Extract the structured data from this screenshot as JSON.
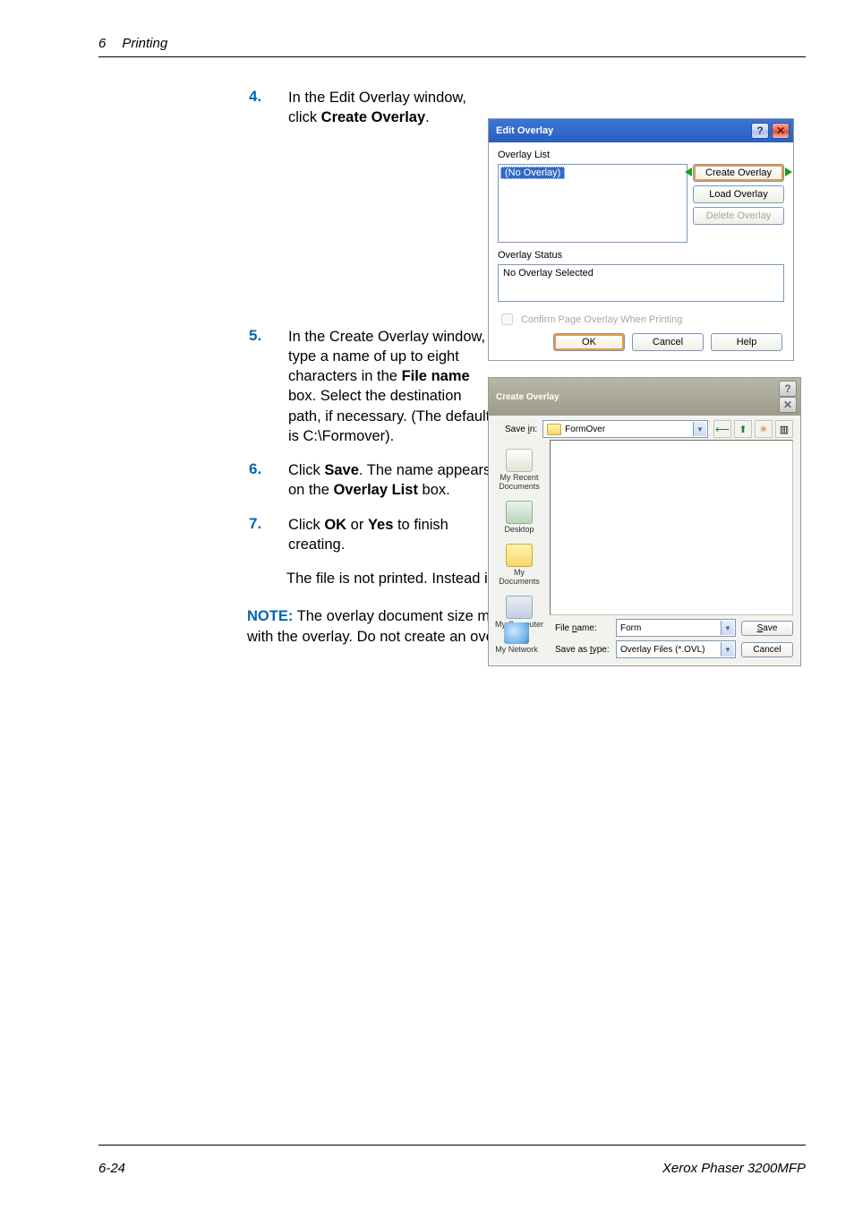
{
  "header": {
    "chapterNum": "6",
    "chapterTitle": "Printing"
  },
  "steps": {
    "four": {
      "n": "4.",
      "t1": "In the Edit Overlay window, click ",
      "b1": "Create Overlay",
      "t2": "."
    },
    "five": {
      "n": "5.",
      "t1": "In the Create Overlay window, type a name of up to eight characters in the ",
      "b1": "File name",
      "t2": " box. Select the destination path, if necessary. (The default is C:\\Formover)."
    },
    "six": {
      "n": "6.",
      "t1": "Click ",
      "b1": "Save",
      "t2": ". The name appears on the ",
      "b2": "Overlay List",
      "t3": " box."
    },
    "seven": {
      "n": "7.",
      "t1": "Click ",
      "b1": "OK",
      "t2": " or ",
      "b2": "Yes",
      "t3": " to finish creating."
    },
    "finalLine": "The file is not printed. Instead it is stored on your computer hard disk drive."
  },
  "note": {
    "label": "NOTE:",
    "text": " The overlay document size must be the same as the documents you print with the overlay. Do not create an overlay with a watermark."
  },
  "editOverlay": {
    "title": "Edit Overlay",
    "help": "?",
    "close": "✕",
    "overlayListLabel": "Overlay List",
    "selected": "(No Overlay)",
    "createBtn": "Create Overlay",
    "loadBtn": "Load Overlay",
    "deleteBtn": "Delete Overlay",
    "statusLabel": "Overlay Status",
    "statusText": "No Overlay Selected",
    "confirmChk": "Confirm Page Overlay When Printing",
    "ok": "OK",
    "cancel": "Cancel",
    "helpBtn": "Help"
  },
  "createOverlay": {
    "title": "Create Overlay",
    "help": "?",
    "close": "✕",
    "saveInLabelPre": "Save ",
    "saveInLabelU": "i",
    "saveInLabelPost": "n:",
    "saveInValue": "FormOver",
    "back": "⟵",
    "up": "⬆",
    "new": "✳",
    "view": "▥",
    "places": {
      "recent": "My Recent Documents",
      "desktop": "Desktop",
      "mydocs": "My Documents",
      "mycomp": "My Computer",
      "network": "My Network"
    },
    "fileNameLabelPre": "File ",
    "fileNameLabelU": "n",
    "fileNameLabelPost": "ame:",
    "fileNameValue": "Form",
    "saveTypeLabelPre": "Save as ",
    "saveTypeLabelU": "t",
    "saveTypeLabelPost": "ype:",
    "saveTypeValue": "Overlay Files (*.OVL)",
    "saveBtnU": "S",
    "saveBtnPost": "ave",
    "cancelBtn": "Cancel"
  },
  "footer": {
    "page": "6-24",
    "product": "Xerox Phaser 3200MFP"
  }
}
